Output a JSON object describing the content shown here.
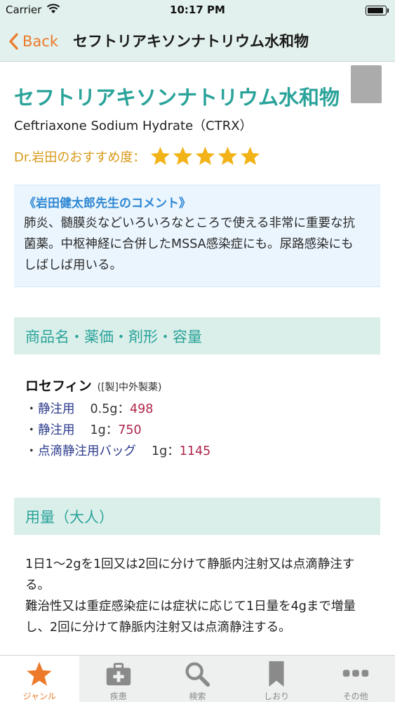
{
  "status_bar": {
    "carrier": "Carrier",
    "time": "10:17 PM",
    "wifi_icon": "wifi-icon",
    "battery_icon": "battery-icon"
  },
  "nav": {
    "back_label": "Back",
    "title": "セフトリアキソンナトリウム水和物",
    "accent_color": "#ec7a2a"
  },
  "drug": {
    "name_jp": "セフトリアキソンナトリウム水和物",
    "name_en": "Ceftriaxone Sodium Hydrate（CTRX）",
    "title_color": "#2aa39a"
  },
  "recommendation": {
    "label": "Dr.岩田のおすすめ度：",
    "stars": 5,
    "max_stars": 5
  },
  "comment": {
    "heading": "《岩田健太郎先生のコメント》",
    "body": "肺炎、髄膜炎などいろいろなところで使える非常に重要な抗菌薬。中枢神経に合併したMSSA感染症にも。尿路感染にもしばしば用いる。"
  },
  "sections": {
    "products_title": "商品名・薬価・剤形・容量",
    "dosage_title": "用量（大人）"
  },
  "product": {
    "name": "ロセフィン",
    "maker": "([製]中外製薬)",
    "specs": [
      {
        "form": "静注用",
        "size": "0.5g：",
        "price": "498"
      },
      {
        "form": "静注用",
        "size": "1g：",
        "price": "750"
      },
      {
        "form": "点滴静注用バッグ",
        "size": "1g：",
        "price": "1145"
      }
    ]
  },
  "dosage": {
    "line1": "1日1～2gを1回又は2回に分けて静脈内注射又は点滴静注する。",
    "line2": "難治性又は重症感染症には症状に応じて1日量を4gまで増量し、2回に分けて静脈内注射又は点滴静注する。"
  },
  "tabbar": {
    "tabs": [
      {
        "label": "ジャンル",
        "icon": "star-icon",
        "active": true
      },
      {
        "label": "疾患",
        "icon": "medical-kit-icon",
        "active": false
      },
      {
        "label": "検索",
        "icon": "search-icon",
        "active": false
      },
      {
        "label": "しおり",
        "icon": "bookmark-icon",
        "active": false
      },
      {
        "label": "その他",
        "icon": "more-icon",
        "active": false
      }
    ]
  }
}
